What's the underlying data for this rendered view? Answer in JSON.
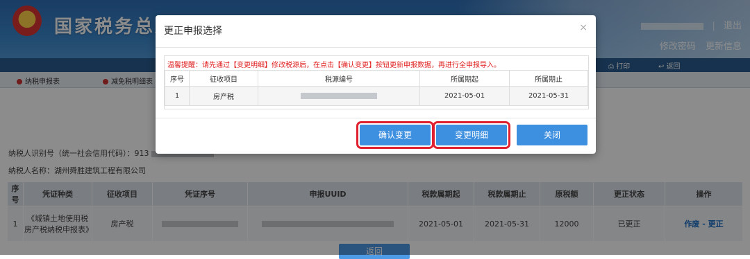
{
  "header": {
    "title": "国家税务总局",
    "logout": "退出",
    "links": [
      "修改密码",
      "更新信息"
    ]
  },
  "toolbar": {
    "print": "打印",
    "back": "返回"
  },
  "tabs": [
    "纳税申报表",
    "减免税明细表"
  ],
  "taxpayer": {
    "id_label": "纳税人识别号（统一社会信用代码）：",
    "id_value_prefix": "913",
    "name_label": "纳税人名称：",
    "name_value": "湖州舜胜建筑工程有限公司"
  },
  "main_table": {
    "headers": [
      "序号",
      "凭证种类",
      "征收项目",
      "凭证序号",
      "申报UUID",
      "税款属期起",
      "税款属期止",
      "原税额",
      "更正状态",
      "操作"
    ],
    "rows": [
      {
        "index": "1",
        "voucher_type": "《城镇土地使用税 房产税纳税申报表》",
        "item": "房产税",
        "period_start": "2021-05-01",
        "period_end": "2021-05-31",
        "amount": "12000",
        "status": "已更正",
        "action_void": "作废",
        "action_sep": " - ",
        "action_correct": "更正"
      }
    ]
  },
  "back_button": "返回",
  "modal": {
    "title": "更正申报选择",
    "close": "×",
    "warning": "温馨提醒：请先通过【变更明细】修改税源后，在点击【确认变更】按钮更新申报数据，再进行全申报导入。",
    "headers": [
      "序号",
      "征收项目",
      "税源编号",
      "所属期起",
      "所属期止"
    ],
    "rows": [
      {
        "index": "1",
        "item": "房产税",
        "start": "2021-05-01",
        "end": "2021-05-31"
      }
    ],
    "buttons": {
      "confirm": "确认变更",
      "detail": "变更明细",
      "close": "关闭"
    }
  }
}
